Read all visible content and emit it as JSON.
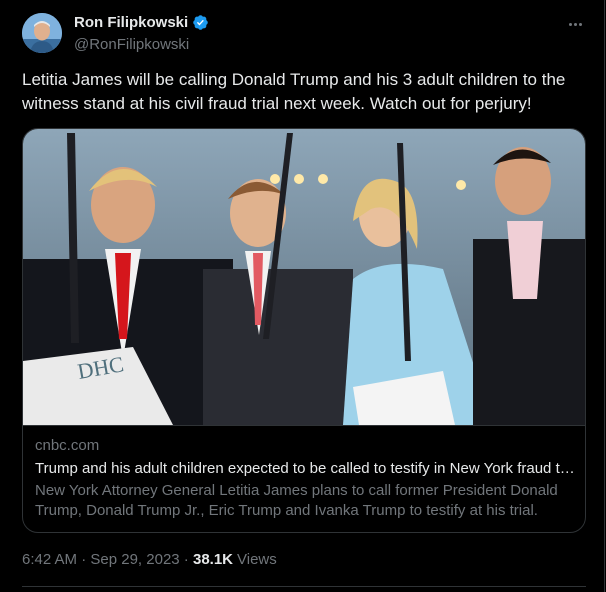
{
  "author": {
    "name": "Ron Filipkowski",
    "handle": "@RonFilipkowski",
    "verified": true
  },
  "tweet": {
    "text": "Letitia James will be calling Donald Trump and his 3 adult children to the witness stand at his civil fraud trial next week. Watch out for perjury!"
  },
  "card": {
    "domain": "cnbc.com",
    "title": "Trump and his adult children expected to be called to testify in New York fraud trial",
    "description": "New York Attorney General Letitia James plans to call former President Donald Trump, Donald Trump Jr., Eric Trump and Ivanka Trump to testify at his trial.",
    "image_alt": "photo of four people in formal wear holding large ribbon-cutting scissors",
    "image_sign_text": "DHC"
  },
  "meta": {
    "time": "6:42 AM",
    "separator": " · ",
    "date": "Sep 29, 2023",
    "views_count": "38.1K",
    "views_label": "Views"
  },
  "colors": {
    "background": "#000000",
    "text": "#e7e9ea",
    "secondary": "#71767b",
    "border": "#2f3336",
    "verified": "#1d9bf0"
  }
}
